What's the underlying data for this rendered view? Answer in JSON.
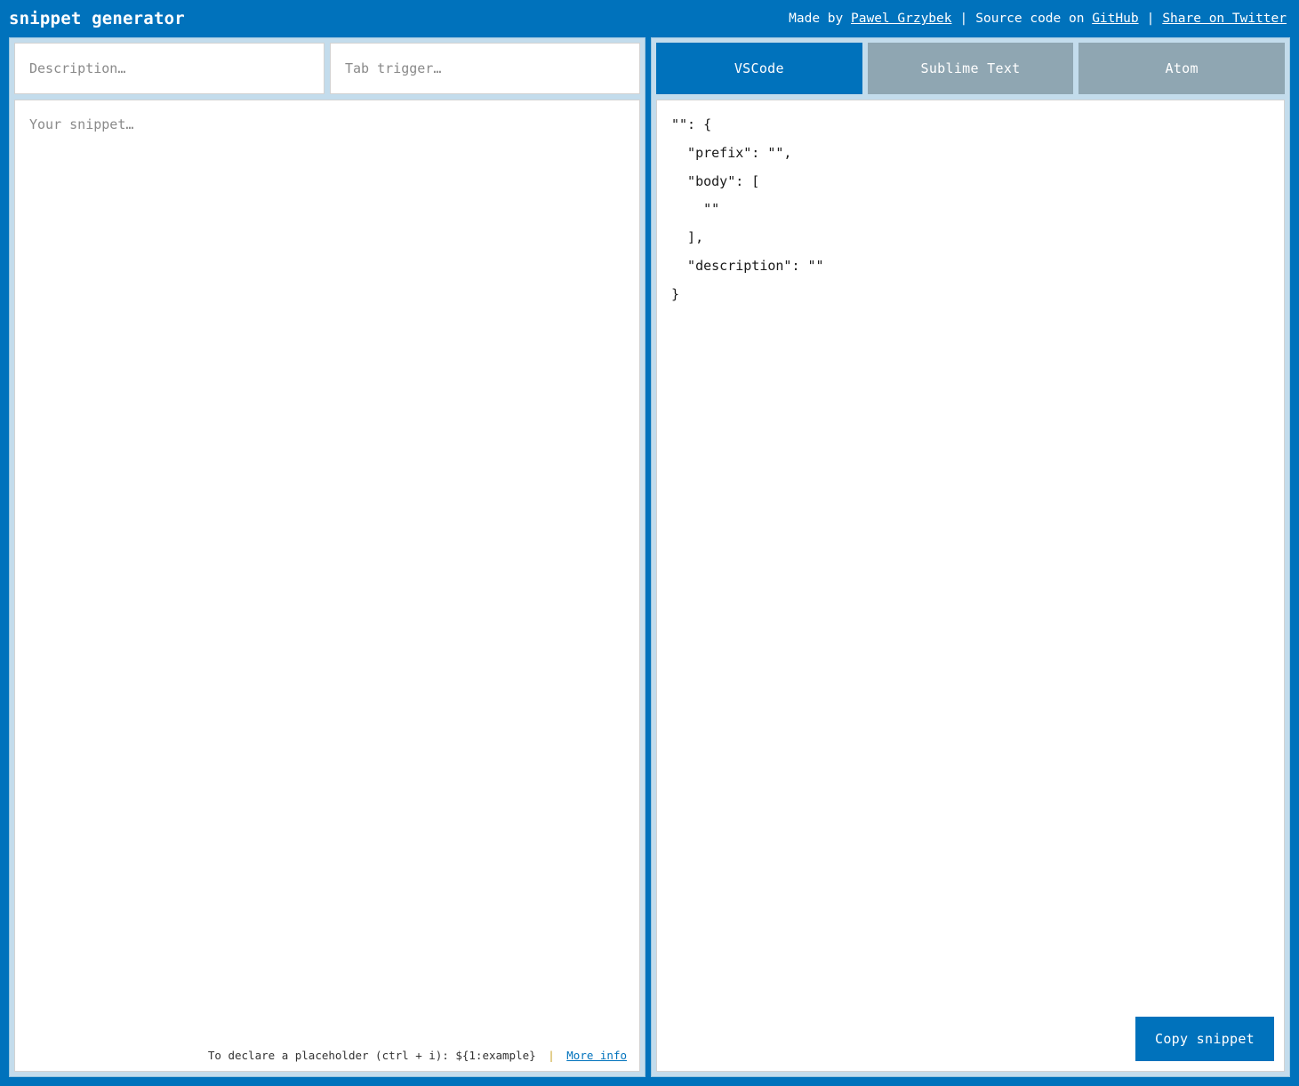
{
  "header": {
    "title": "snippet generator",
    "made_by_label": "Made by",
    "author_name": "Pawel Grzybek",
    "separator": "|",
    "source_label": "Source code on",
    "source_link": "GitHub",
    "share_link": "Share on Twitter"
  },
  "editor": {
    "description_placeholder": "Description…",
    "description_value": "",
    "tab_trigger_placeholder": "Tab trigger…",
    "tab_trigger_value": "",
    "snippet_placeholder": "Your snippet…",
    "snippet_value": "",
    "hint_text": "To declare a placeholder (ctrl + i): ${1:example}",
    "hint_separator": "|",
    "hint_link": "More info"
  },
  "output": {
    "tabs": [
      {
        "label": "VSCode",
        "active": true
      },
      {
        "label": "Sublime Text",
        "active": false
      },
      {
        "label": "Atom",
        "active": false
      }
    ],
    "code": "\"\": {\n  \"prefix\": \"\",\n  \"body\": [\n    \"\"\n  ],\n  \"description\": \"\"\n}",
    "copy_label": "Copy snippet"
  },
  "colors": {
    "brand_blue": "#0072bc",
    "panel_bg": "#c3dcec",
    "panel_border": "#9ac6e0",
    "tab_inactive": "#8fa6b2",
    "input_border": "#d2d2d2",
    "placeholder": "#8a8a8a",
    "hint_separator": "#c9a227"
  }
}
